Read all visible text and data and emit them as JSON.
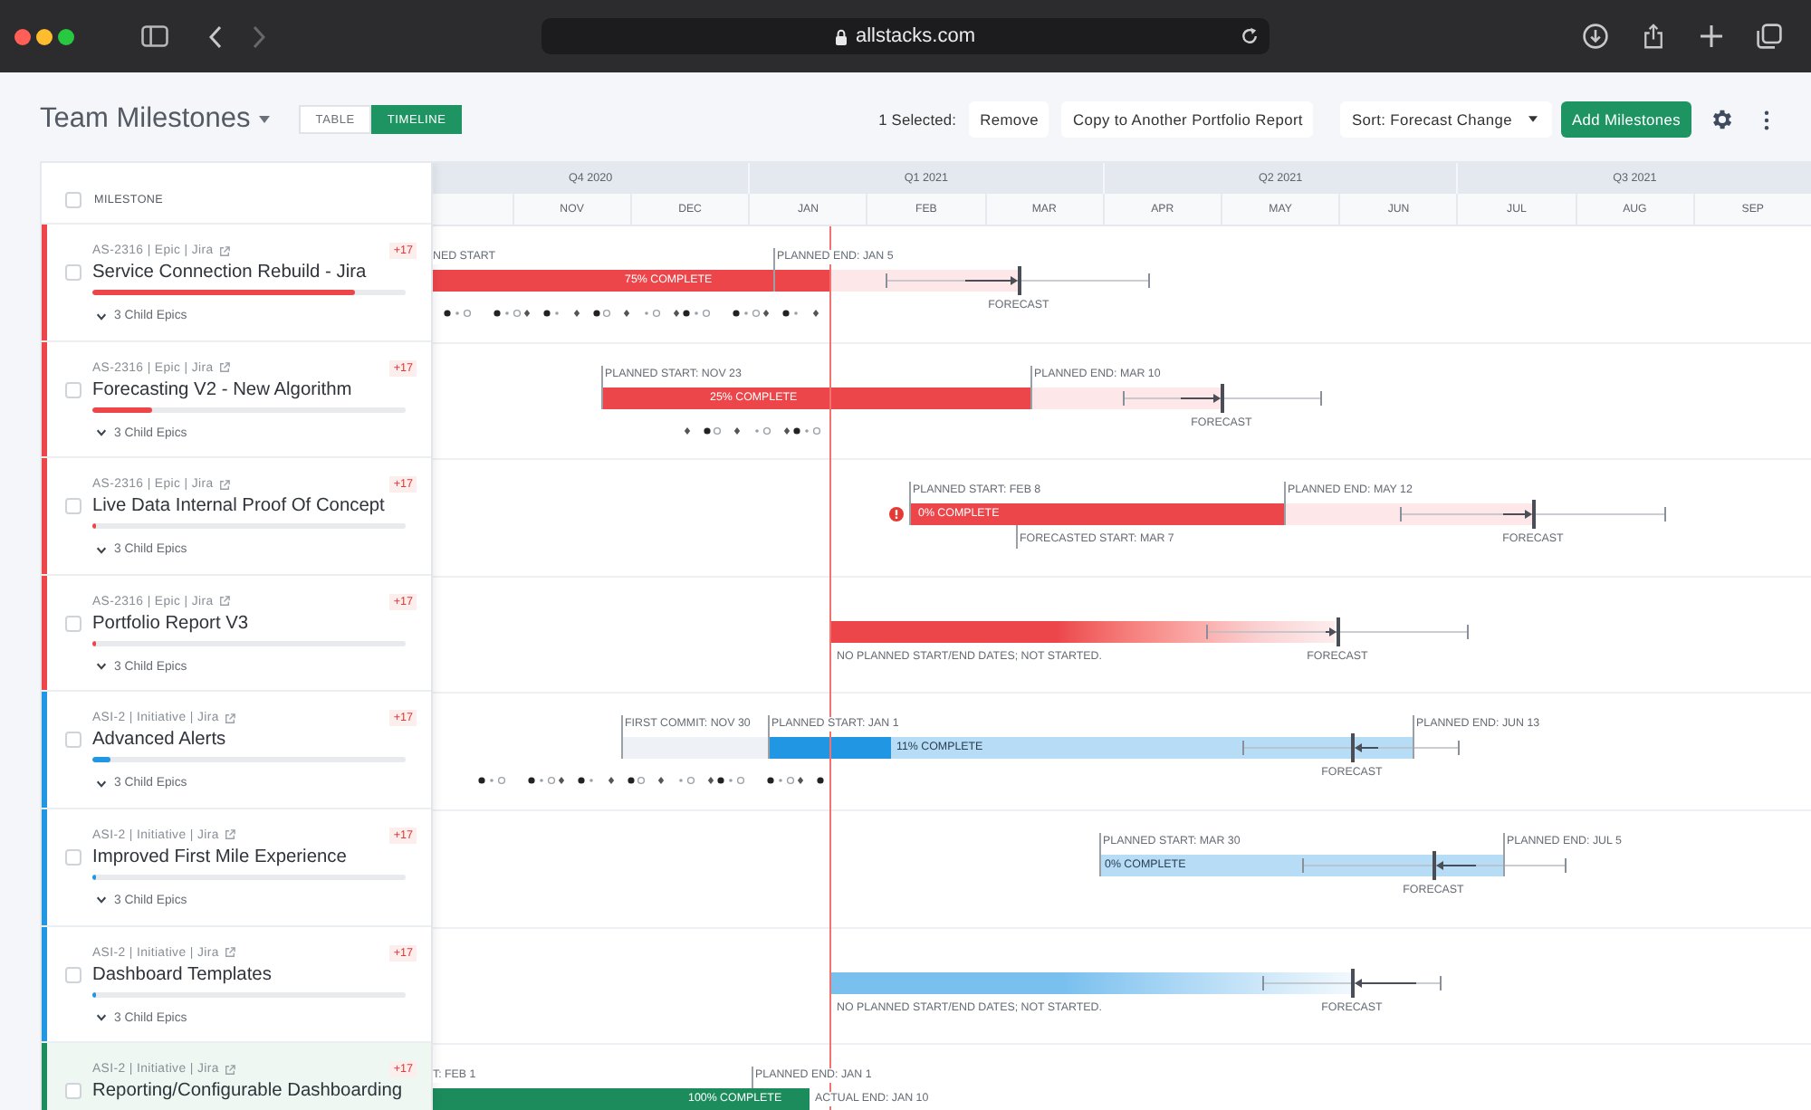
{
  "browser": {
    "url": "allstacks.com"
  },
  "header": {
    "title": "Team Milestones",
    "views": [
      {
        "label": "TABLE",
        "selected": false
      },
      {
        "label": "TIMELINE",
        "selected": true
      }
    ],
    "selection": "1 Selected:",
    "actions": [
      "Remove",
      "Copy to Another Portfolio Report"
    ],
    "sort": "Sort: Forecast Change",
    "add_button": "Add Milestones"
  },
  "list": {
    "header": {
      "label": "MILESTONE",
      "checked": false
    },
    "rows": [
      {
        "meta": "AS-2316 | Epic | Jira",
        "badge": "+17",
        "title": "Service Connection Rebuild - Jira",
        "level": 0.84,
        "child_epics": "3 Child Epics",
        "color": "#ec464b",
        "checked": false,
        "selected": false
      },
      {
        "meta": "AS-2316 | Epic | Jira",
        "badge": "+17",
        "title": "Forecasting V2 - New Algorithm",
        "level": 0.19,
        "child_epics": "3 Child Epics",
        "color": "#ec464b",
        "checked": false,
        "selected": false
      },
      {
        "meta": "AS-2316 | Epic | Jira",
        "badge": "+17",
        "title": "Live Data Internal Proof Of Concept",
        "level": 0,
        "child_epics": "3 Child Epics",
        "color": "#ec464b",
        "checked": false,
        "selected": false
      },
      {
        "meta": "AS-2316 | Epic | Jira",
        "badge": "+17",
        "title": "Portfolio Report V3",
        "level": 0,
        "child_epics": "3 Child Epics",
        "color": "#ec464b",
        "checked": false,
        "selected": false
      },
      {
        "meta": "ASI-2 | Initiative | Jira",
        "badge": "+17",
        "title": "Advanced Alerts",
        "level": 0.06,
        "child_epics": "3 Child Epics",
        "color": "#2196e3",
        "checked": false,
        "selected": false
      },
      {
        "meta": "ASI-2 | Initiative | Jira",
        "badge": "+17",
        "title": "Improved First Mile Experience",
        "level": 0,
        "child_epics": "3 Child Epics",
        "color": "#2196e3",
        "checked": false,
        "selected": false
      },
      {
        "meta": "ASI-2 | Initiative | Jira",
        "badge": "+17",
        "title": "Dashboard Templates",
        "level": 0,
        "child_epics": "3 Child Epics",
        "color": "#2196e3",
        "checked": false,
        "selected": false
      },
      {
        "meta": "ASI-2 | Initiative | Jira",
        "badge": "+17",
        "title": "Reporting/Configurable Dashboarding",
        "color": "#1c8c5c",
        "checked": false,
        "selected": true
      }
    ]
  },
  "timeline": {
    "quarters": [
      "Q4 2020",
      "Q1 2021",
      "Q2 2021",
      "Q3 2021"
    ],
    "months": [
      "NOV",
      "DEC",
      "JAN",
      "FEB",
      "MAR",
      "APR",
      "MAY",
      "JUN",
      "JUL",
      "AUG",
      "SEP"
    ],
    "rows": [
      {
        "labels": [
          "NED START",
          "PLANNED END: JAN 5",
          "FORECAST"
        ],
        "bar_label": "75% COMPLETE",
        "alert": false,
        "activity": true
      },
      {
        "labels": [
          "PLANNED START: NOV 23",
          "PLANNED END: MAR 10",
          "FORECAST"
        ],
        "bar_label": "25% COMPLETE",
        "alert": false,
        "activity": true
      },
      {
        "labels": [
          "PLANNED START: FEB 8",
          "PLANNED END: MAY 12",
          "FORECASTED START: MAR 7",
          "FORECAST"
        ],
        "bar_label": "0% COMPLETE",
        "alert": true,
        "activity": false
      },
      {
        "labels": [
          "NO PLANNED START/END DATES; NOT STARTED.",
          "FORECAST"
        ],
        "alert": false,
        "activity": false
      },
      {
        "labels": [
          "FIRST COMMIT: NOV 30",
          "PLANNED START: JAN 1",
          "PLANNED END: JUN 13",
          "FORECAST"
        ],
        "bar_label": "11% COMPLETE",
        "alert": false,
        "activity": true
      },
      {
        "labels": [
          "PLANNED START: MAR 30",
          "PLANNED END: JUL 5",
          "FORECAST"
        ],
        "bar_label": "0% COMPLETE",
        "alert": false,
        "activity": false
      },
      {
        "labels": [
          "NO PLANNED START/END DATES; NOT STARTED.",
          "FORECAST"
        ],
        "alert": false,
        "activity": false
      },
      {
        "labels": [
          "T: FEB 1",
          "PLANNED END: JAN 1",
          "ACTUAL END: JAN 10"
        ],
        "bar_label": "100% COMPLETE",
        "alert": false,
        "activity": false
      }
    ]
  }
}
